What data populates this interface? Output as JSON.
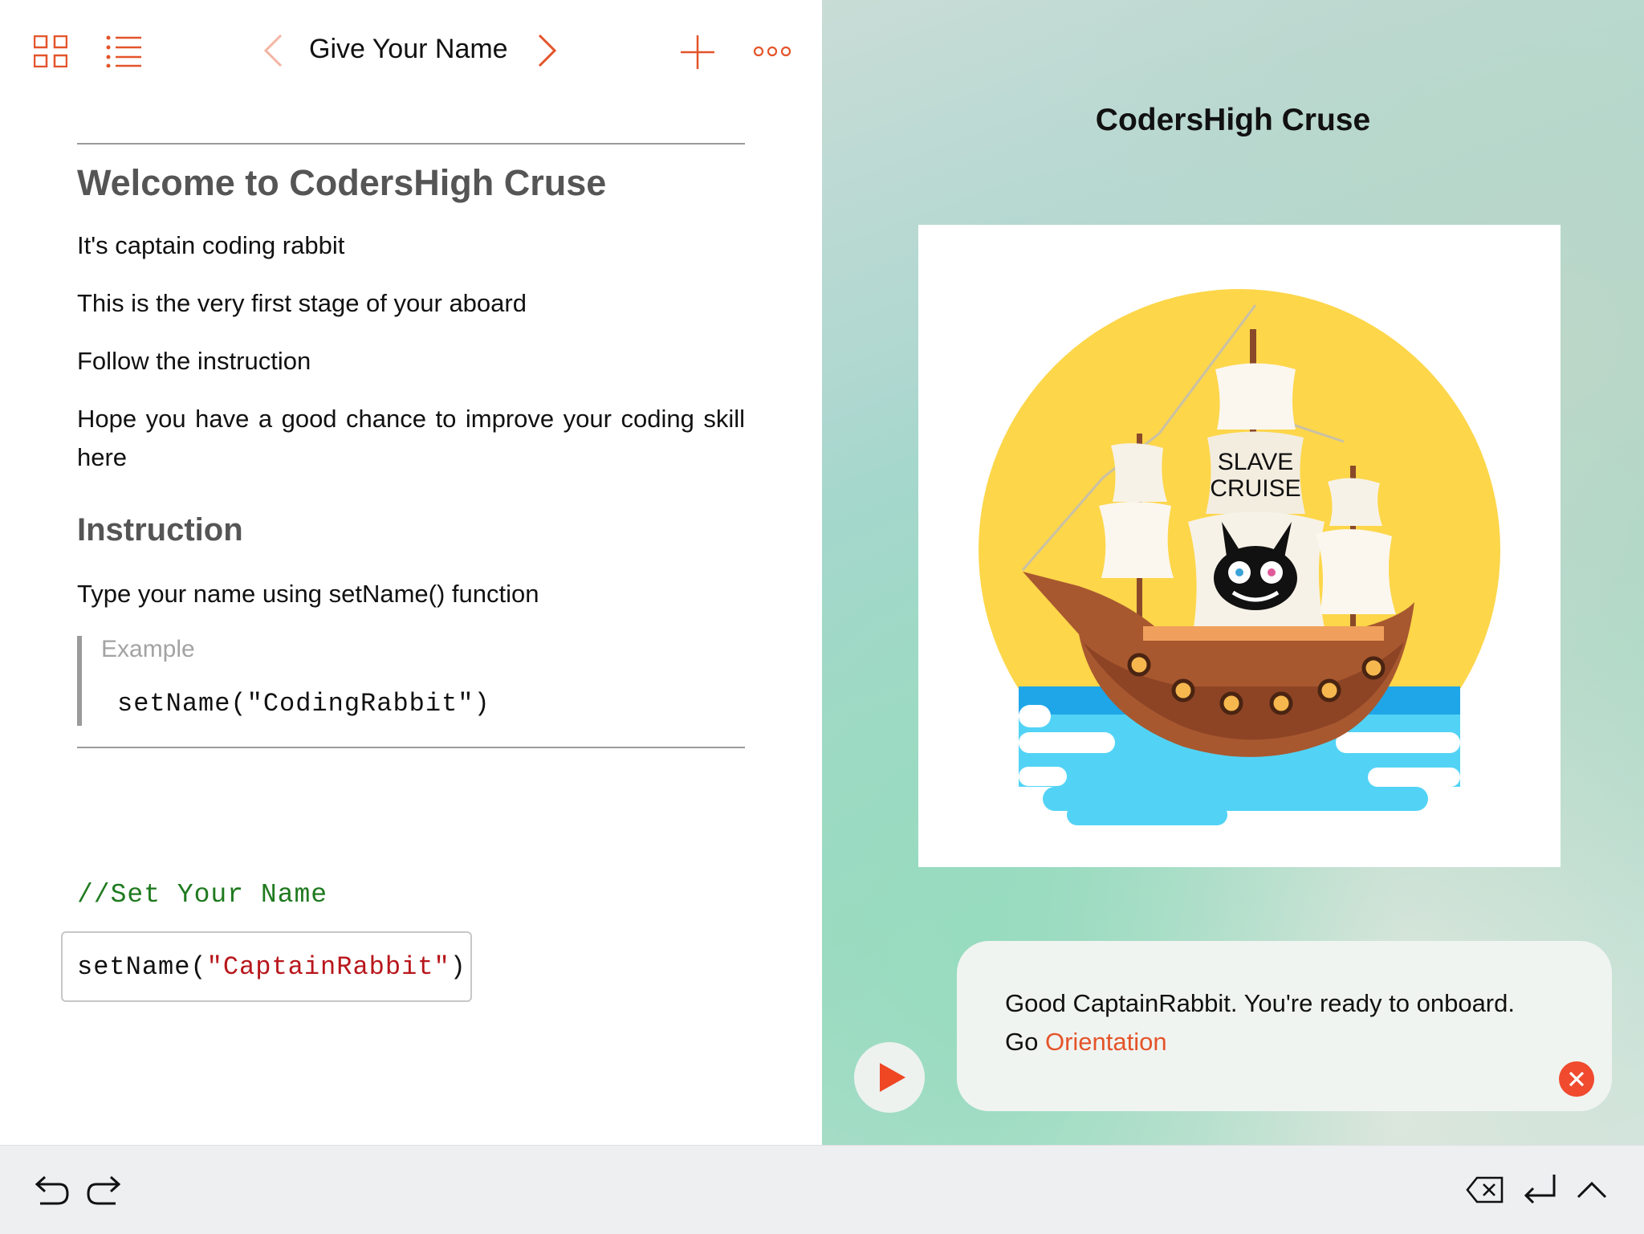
{
  "toolbar": {
    "title": "Give Your Name"
  },
  "document": {
    "heading": "Welcome to CodersHigh Cruse",
    "paragraphs": [
      "It's captain coding rabbit",
      "This is the very first stage of your aboard",
      "Follow the instruction",
      "Hope you have a good chance to improve your coding skill here"
    ],
    "instruction_heading": "Instruction",
    "instruction_text": "Type your name using setName() function",
    "example_label": "Example",
    "example_code": "setName(\"CodingRabbit\")"
  },
  "editor": {
    "comment": "//Set Your Name",
    "code_prefix": "setName(",
    "code_string": "\"CaptainRabbit\"",
    "code_suffix": ")"
  },
  "live_view": {
    "title": "CodersHigh Cruse",
    "sail_text_line1": "SLAVE",
    "sail_text_line2": "CRUISE",
    "message_text": "Good CaptainRabbit. You're ready to onboard.",
    "message_go": "Go ",
    "message_link": "Orientation"
  },
  "colors": {
    "accent": "#e4542a",
    "string": "#b8161b",
    "comment": "#1f7a1f",
    "sun": "#fdd64a",
    "water": "#52d3f5"
  },
  "icons": [
    "grid-icon",
    "list-icon",
    "chevron-left-icon",
    "chevron-right-icon",
    "plus-icon",
    "more-icon",
    "play-icon",
    "close-icon",
    "undo-icon",
    "redo-icon",
    "delete-icon",
    "return-icon",
    "chevron-up-icon"
  ]
}
